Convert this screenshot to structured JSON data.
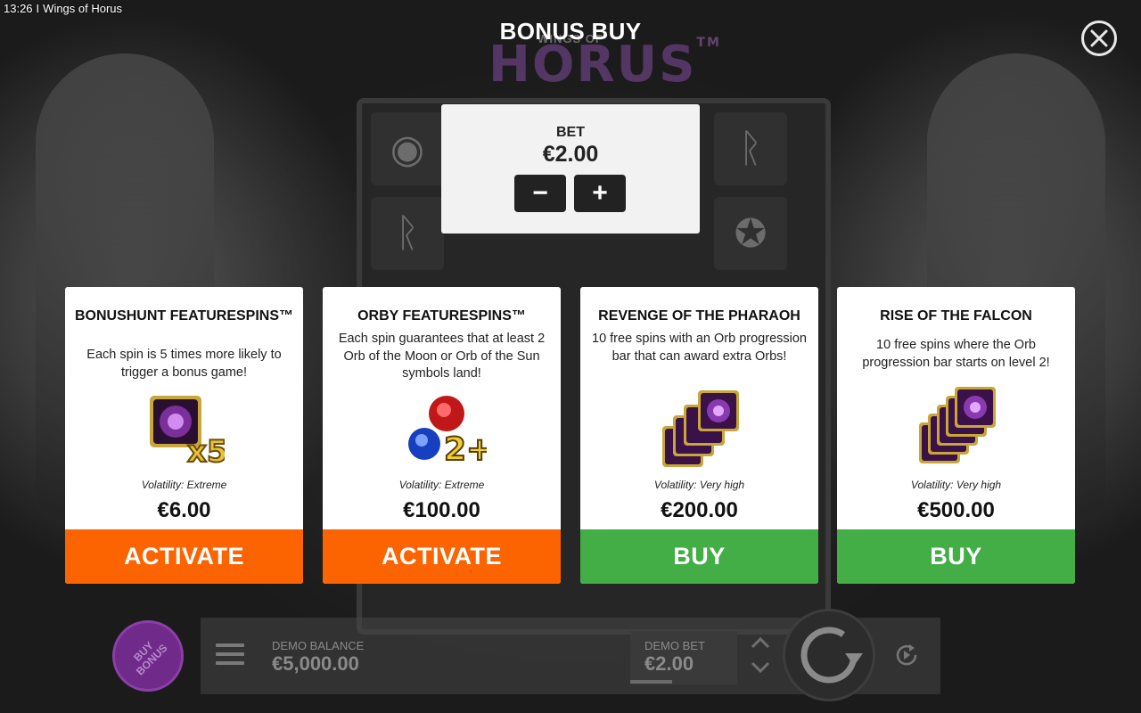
{
  "status_bar": {
    "time": "13:26",
    "separator": "I",
    "app_title": "Wings of Horus"
  },
  "modal": {
    "title": "BONUS BUY"
  },
  "game_logo": {
    "top_text": "WINGS OF",
    "main_text": "HORUS",
    "mark": "TM"
  },
  "bet_panel": {
    "label": "BET",
    "value": "€2.00",
    "minus_label": "−",
    "plus_label": "+"
  },
  "cards": [
    {
      "title": "BONUSHUNT FEATURESPINS™",
      "description": "Each spin is 5 times more likely to trigger a bonus game!",
      "art_label": "x5",
      "volatility": "Volatility: Extreme",
      "price": "€6.00",
      "action_label": "ACTIVATE",
      "action_color": "#fb6400"
    },
    {
      "title": "ORBY FEATURESPINS™",
      "description": "Each spin guarantees that at least 2 Orb of the Moon or Orb of the Sun symbols land!",
      "art_label": "2+",
      "volatility": "Volatility: Extreme",
      "price": "€100.00",
      "action_label": "ACTIVATE",
      "action_color": "#fb6400"
    },
    {
      "title": "REVENGE OF THE PHARAOH",
      "description": "10 free spins with an Orb progression bar that can award extra Orbs!",
      "volatility": "Volatility: Very high",
      "price": "€200.00",
      "action_label": "BUY",
      "action_color": "#43ad46"
    },
    {
      "title": "RISE OF THE FALCON",
      "description": "10 free spins where the Orb progression bar starts on level 2!",
      "volatility": "Volatility: Very high",
      "price": "€500.00",
      "action_label": "BUY",
      "action_color": "#43ad46"
    }
  ],
  "bottom_bar": {
    "buy_bonus_label": "BUY BONUS",
    "balance_label": "DEMO BALANCE",
    "balance_value": "€5,000.00",
    "bet_label": "DEMO BET",
    "bet_value": "€2.00"
  },
  "colors": {
    "activate": "#fb6400",
    "buy": "#43ad46",
    "buy_bonus": "#6f2a8a",
    "card_bg": "#ffffff"
  }
}
